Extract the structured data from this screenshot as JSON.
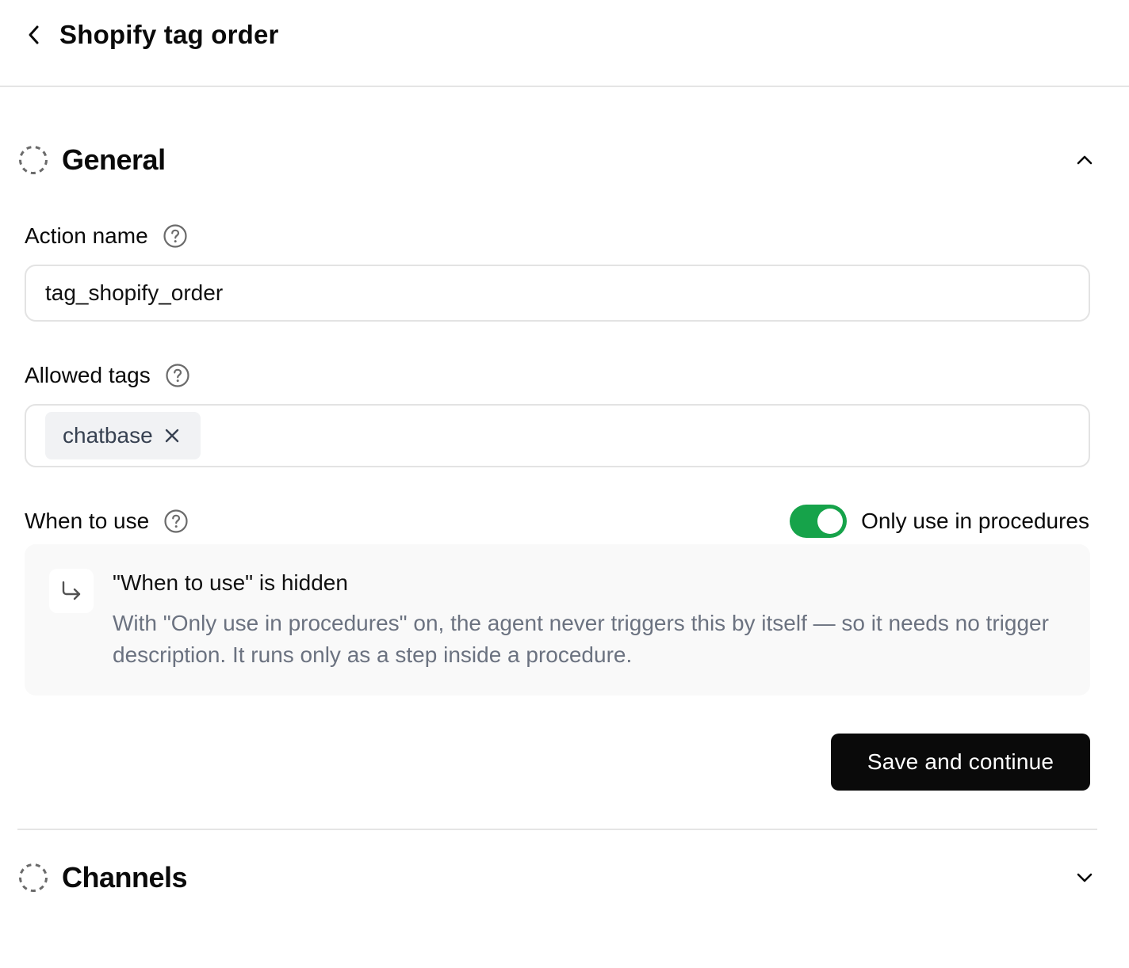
{
  "header": {
    "title": "Shopify tag order"
  },
  "sections": {
    "general": {
      "title": "General"
    },
    "channels": {
      "title": "Channels"
    }
  },
  "fields": {
    "action_name": {
      "label": "Action name",
      "value": "tag_shopify_order"
    },
    "allowed_tags": {
      "label": "Allowed tags",
      "tags": [
        "chatbase"
      ]
    },
    "when_to_use": {
      "label": "When to use",
      "toggle_label": "Only use in procedures",
      "toggle_on": true
    }
  },
  "info": {
    "title": "\"When to use\" is hidden",
    "description": "With \"Only use in procedures\" on, the agent never triggers this by itself — so it needs no trigger description. It runs only as a step inside a procedure."
  },
  "actions": {
    "save_label": "Save and continue"
  },
  "colors": {
    "toggle_on": "#16a34a",
    "primary": "#0a0a0a"
  },
  "icons": {
    "back": "chevron-left-icon",
    "section_status": "dashed-circle-icon",
    "help": "question-circle-icon",
    "expand_general": "chevron-up-icon",
    "expand_channels": "chevron-down-icon",
    "remove_tag": "close-icon",
    "info": "arrow-corner-down-right-icon"
  }
}
